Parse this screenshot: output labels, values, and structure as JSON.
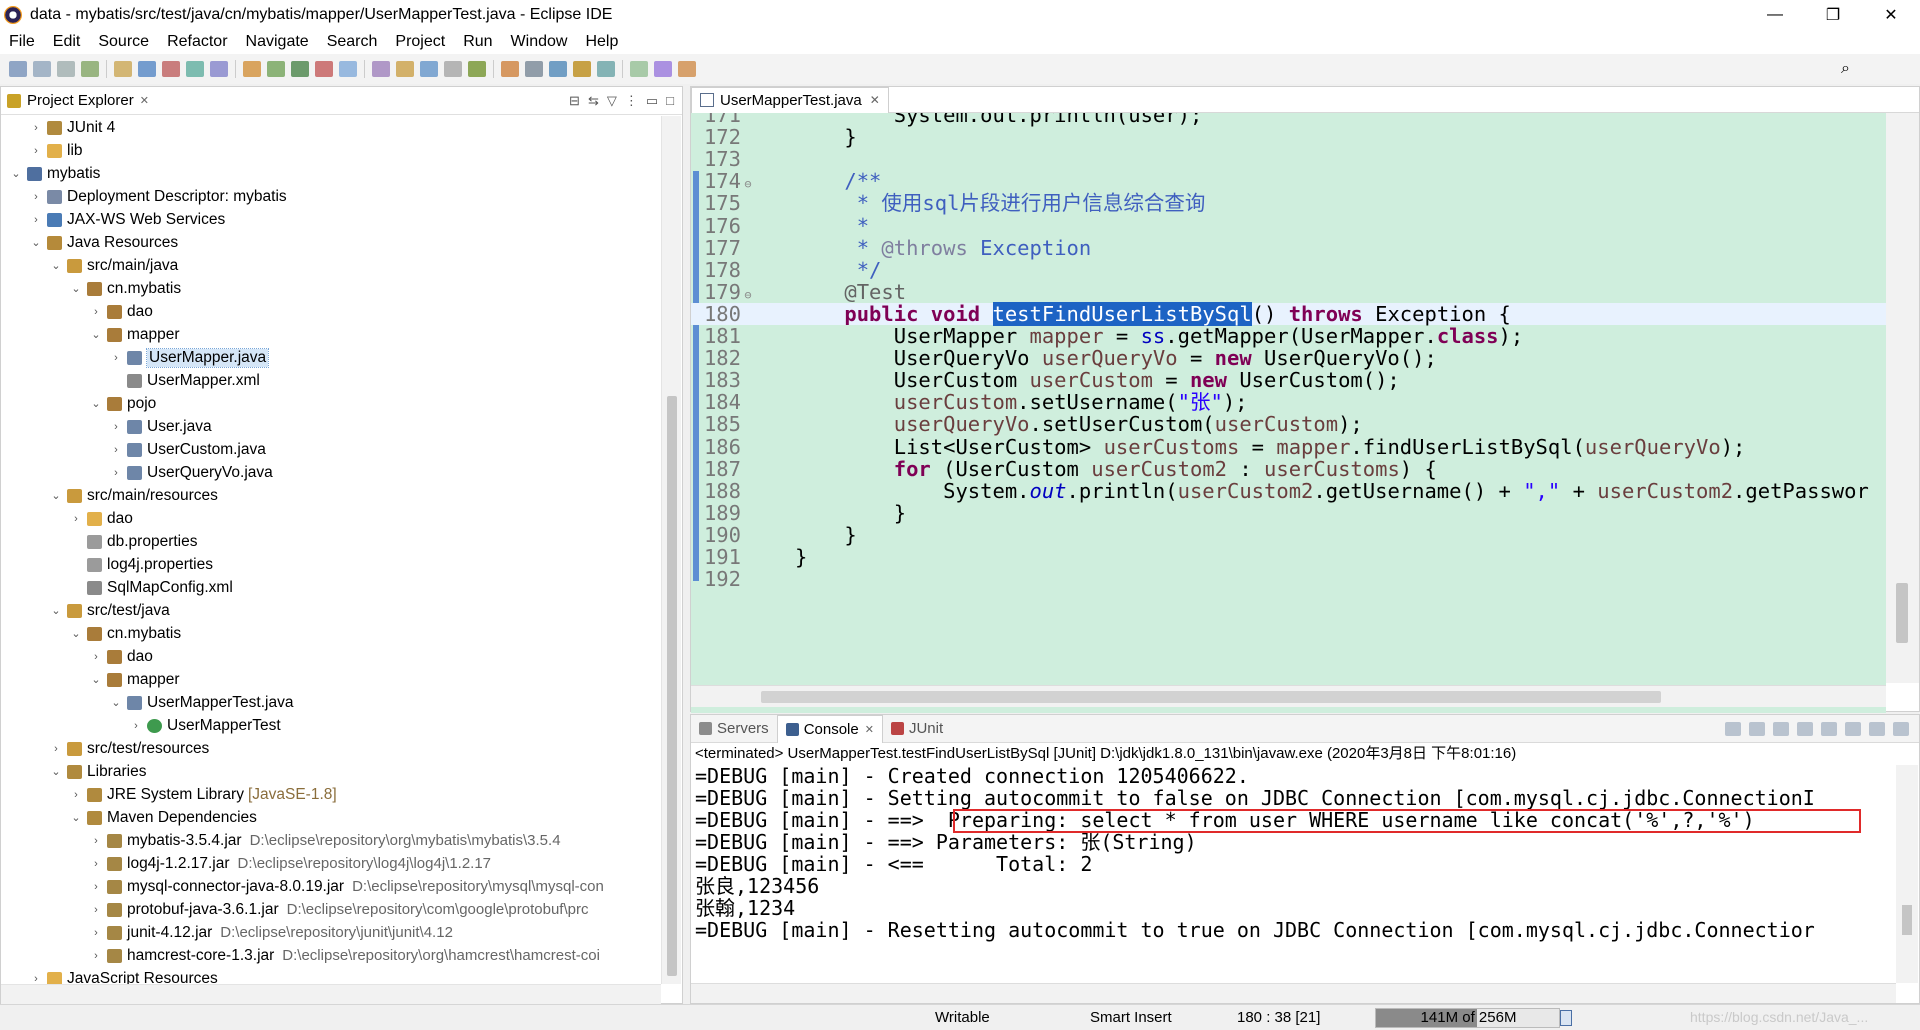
{
  "window": {
    "title": "data - mybatis/src/test/java/cn/mybatis/mapper/UserMapperTest.java - Eclipse IDE",
    "minimize": "—",
    "restore": "❐",
    "close": "✕"
  },
  "menu": [
    "File",
    "Edit",
    "Source",
    "Refactor",
    "Navigate",
    "Search",
    "Project",
    "Run",
    "Window",
    "Help"
  ],
  "explorer": {
    "title": "Project Explorer",
    "close": "✕",
    "tree": [
      {
        "indent": 1,
        "arrow": "›",
        "icon": "library-icon",
        "label": "JUnit 4"
      },
      {
        "indent": 1,
        "arrow": "›",
        "icon": "folder-icon",
        "label": "lib"
      },
      {
        "indent": 0,
        "arrow": "⌄",
        "icon": "web-project-icon",
        "label": "mybatis"
      },
      {
        "indent": 1,
        "arrow": "›",
        "icon": "deployment-descriptor-icon",
        "label": "Deployment Descriptor: mybatis"
      },
      {
        "indent": 1,
        "arrow": "›",
        "icon": "web-services-icon",
        "label": "JAX-WS Web Services"
      },
      {
        "indent": 1,
        "arrow": "⌄",
        "icon": "java-resources-icon",
        "label": "Java Resources"
      },
      {
        "indent": 2,
        "arrow": "⌄",
        "icon": "source-folder-icon",
        "label": "src/main/java"
      },
      {
        "indent": 3,
        "arrow": "⌄",
        "icon": "package-icon",
        "label": "cn.mybatis"
      },
      {
        "indent": 4,
        "arrow": "›",
        "icon": "package-icon",
        "label": "dao"
      },
      {
        "indent": 4,
        "arrow": "⌄",
        "icon": "package-icon",
        "label": "mapper"
      },
      {
        "indent": 5,
        "arrow": "›",
        "icon": "java-file-icon",
        "label": "UserMapper.java",
        "selected": true
      },
      {
        "indent": 5,
        "arrow": "",
        "icon": "xml-file-icon",
        "label": "UserMapper.xml"
      },
      {
        "indent": 4,
        "arrow": "⌄",
        "icon": "package-icon",
        "label": "pojo"
      },
      {
        "indent": 5,
        "arrow": "›",
        "icon": "java-file-icon",
        "label": "User.java"
      },
      {
        "indent": 5,
        "arrow": "›",
        "icon": "java-file-icon",
        "label": "UserCustom.java"
      },
      {
        "indent": 5,
        "arrow": "›",
        "icon": "java-file-icon",
        "label": "UserQueryVo.java"
      },
      {
        "indent": 2,
        "arrow": "⌄",
        "icon": "source-folder-icon",
        "label": "src/main/resources"
      },
      {
        "indent": 3,
        "arrow": "›",
        "icon": "folder-icon",
        "label": "dao"
      },
      {
        "indent": 3,
        "arrow": "",
        "icon": "properties-file-icon",
        "label": "db.properties"
      },
      {
        "indent": 3,
        "arrow": "",
        "icon": "properties-file-icon",
        "label": "log4j.properties"
      },
      {
        "indent": 3,
        "arrow": "",
        "icon": "xml-file-icon",
        "label": "SqlMapConfig.xml"
      },
      {
        "indent": 2,
        "arrow": "⌄",
        "icon": "source-folder-icon",
        "label": "src/test/java"
      },
      {
        "indent": 3,
        "arrow": "⌄",
        "icon": "package-icon",
        "label": "cn.mybatis"
      },
      {
        "indent": 4,
        "arrow": "›",
        "icon": "package-icon",
        "label": "dao"
      },
      {
        "indent": 4,
        "arrow": "⌄",
        "icon": "package-icon",
        "label": "mapper"
      },
      {
        "indent": 5,
        "arrow": "⌄",
        "icon": "java-file-icon",
        "label": "UserMapperTest.java"
      },
      {
        "indent": 6,
        "arrow": "›",
        "icon": "class-icon",
        "label": "UserMapperTest"
      },
      {
        "indent": 2,
        "arrow": "›",
        "icon": "source-folder-icon",
        "label": "src/test/resources"
      },
      {
        "indent": 2,
        "arrow": "⌄",
        "icon": "library-icon",
        "label": "Libraries"
      },
      {
        "indent": 3,
        "arrow": "›",
        "icon": "library-icon",
        "label": "JRE System Library",
        "sub": "[JavaSE-1.8]"
      },
      {
        "indent": 3,
        "arrow": "⌄",
        "icon": "library-icon",
        "label": "Maven Dependencies"
      },
      {
        "indent": 4,
        "arrow": "›",
        "icon": "jar-icon",
        "label": "mybatis-3.5.4.jar",
        "path": "D:\\eclipse\\repository\\org\\mybatis\\mybatis\\3.5.4"
      },
      {
        "indent": 4,
        "arrow": "›",
        "icon": "jar-icon",
        "label": "log4j-1.2.17.jar",
        "path": "D:\\eclipse\\repository\\log4j\\log4j\\1.2.17"
      },
      {
        "indent": 4,
        "arrow": "›",
        "icon": "jar-icon",
        "label": "mysql-connector-java-8.0.19.jar",
        "path": "D:\\eclipse\\repository\\mysql\\mysql-con"
      },
      {
        "indent": 4,
        "arrow": "›",
        "icon": "jar-icon",
        "label": "protobuf-java-3.6.1.jar",
        "path": "D:\\eclipse\\repository\\com\\google\\protobuf\\prc"
      },
      {
        "indent": 4,
        "arrow": "›",
        "icon": "jar-icon",
        "label": "junit-4.12.jar",
        "path": "D:\\eclipse\\repository\\junit\\junit\\4.12"
      },
      {
        "indent": 4,
        "arrow": "›",
        "icon": "jar-icon",
        "label": "hamcrest-core-1.3.jar",
        "path": "D:\\eclipse\\repository\\org\\hamcrest\\hamcrest-coi"
      },
      {
        "indent": 1,
        "arrow": "›",
        "icon": "folder-icon",
        "label": "JavaScript Resources"
      }
    ]
  },
  "editor": {
    "tab": "UserMapperTest.java",
    "close": "✕",
    "lines": [
      {
        "n": "171",
        "fold": "",
        "html": "        System.out.println(user);"
      },
      {
        "n": "172",
        "fold": "",
        "html": "    }"
      },
      {
        "n": "173",
        "fold": "",
        "html": ""
      },
      {
        "n": "174",
        "fold": "⊖",
        "html": "    <span class=\"cm\">/**</span>"
      },
      {
        "n": "175",
        "fold": "",
        "html": "     <span class=\"cm\">* 使用sql片段进行用户信息综合查询</span>"
      },
      {
        "n": "176",
        "fold": "",
        "html": "     <span class=\"cm\">*</span>"
      },
      {
        "n": "177",
        "fold": "",
        "html": "     <span class=\"cm\">* </span><span class=\"cmtag\">@throws</span><span class=\"cm\"> Exception</span>"
      },
      {
        "n": "178",
        "fold": "",
        "html": "     <span class=\"cm\">*/</span>"
      },
      {
        "n": "179",
        "fold": "⊖",
        "html": "    <span class=\"ann\">@Test</span>"
      },
      {
        "n": "180",
        "fold": "",
        "current": true,
        "html": "    <span class=\"kw\">public</span> <span class=\"kw\">void</span> <span class=\"hl\">testFindUserListBySql</span>() <span class=\"kw\">throws</span> Exception {"
      },
      {
        "n": "181",
        "fold": "",
        "html": "        UserMapper <span class=\"fld\">mapper</span> = <span class=\"sfld\" style=\"font-style:normal\">ss</span>.getMapper(UserMapper.<span class=\"kw\">class</span>);"
      },
      {
        "n": "182",
        "fold": "",
        "html": "        UserQueryVo <span class=\"fld\">userQueryVo</span> = <span class=\"kw\">new</span> UserQueryVo();"
      },
      {
        "n": "183",
        "fold": "",
        "html": "        UserCustom <span class=\"fld\">userCustom</span> = <span class=\"kw\">new</span> UserCustom();"
      },
      {
        "n": "184",
        "fold": "",
        "html": "        <span class=\"fld\">userCustom</span>.setUsername(<span class=\"str\">\"张\"</span>);"
      },
      {
        "n": "185",
        "fold": "",
        "html": "        <span class=\"fld\">userQueryVo</span>.setUserCustom(<span class=\"fld\">userCustom</span>);"
      },
      {
        "n": "186",
        "fold": "",
        "html": "        List&lt;UserCustom&gt; <span class=\"fld\">userCustoms</span> = <span class=\"fld\">mapper</span>.findUserListBySql(<span class=\"fld\">userQueryVo</span>);"
      },
      {
        "n": "187",
        "fold": "",
        "html": "        <span class=\"kw\">for</span> (UserCustom <span class=\"fld\">userCustom2</span> : <span class=\"fld\">userCustoms</span>) {"
      },
      {
        "n": "188",
        "fold": "",
        "html": "            System.<span class=\"sfld\">out</span>.println(<span class=\"fld\">userCustom2</span>.getUsername() + <span class=\"str\">\",\"</span> + <span class=\"fld\">userCustom2</span>.getPasswor"
      },
      {
        "n": "189",
        "fold": "",
        "html": "        }"
      },
      {
        "n": "190",
        "fold": "",
        "html": "    }"
      },
      {
        "n": "191",
        "fold": "",
        "html": "}"
      },
      {
        "n": "192",
        "fold": "",
        "html": ""
      }
    ]
  },
  "console": {
    "tabs": [
      {
        "label": "Servers",
        "active": false,
        "icon": "servers-icon"
      },
      {
        "label": "Console",
        "active": true,
        "icon": "console-icon"
      },
      {
        "label": "JUnit",
        "active": false,
        "icon": "junit-icon"
      }
    ],
    "header": "<terminated> UserMapperTest.testFindUserListBySql [JUnit] D:\\jdk\\jdk1.8.0_131\\bin\\javaw.exe (2020年3月8日 下午8:01:16)",
    "lines": [
      "=DEBUG [main] - Created connection 1205406622.",
      "=DEBUG [main] - Setting autocommit to false on JDBC Connection [com.mysql.cj.jdbc.ConnectionI",
      "=DEBUG [main] - ==>  Preparing: select * from user WHERE username like concat('%',?,'%')",
      "=DEBUG [main] - ==> Parameters: 张(String)",
      "=DEBUG [main] - <==      Total: 2",
      "张良,123456",
      "张翰,1234",
      "=DEBUG [main] - Resetting autocommit to true on JDBC Connection [com.mysql.cj.jdbc.Connectior"
    ]
  },
  "status": {
    "writable": "Writable",
    "insert_mode": "Smart Insert",
    "position": "180 : 38 [21]",
    "heap": "141M of 256M",
    "heap_fraction": 0.55,
    "watermark": "https://blog.csdn.net/Java_..."
  },
  "colors": {
    "editor_bg": "#cfeedd",
    "highlight": "#1d63c4",
    "keyword": "#7f0055",
    "redbox": "#e02a2a"
  }
}
